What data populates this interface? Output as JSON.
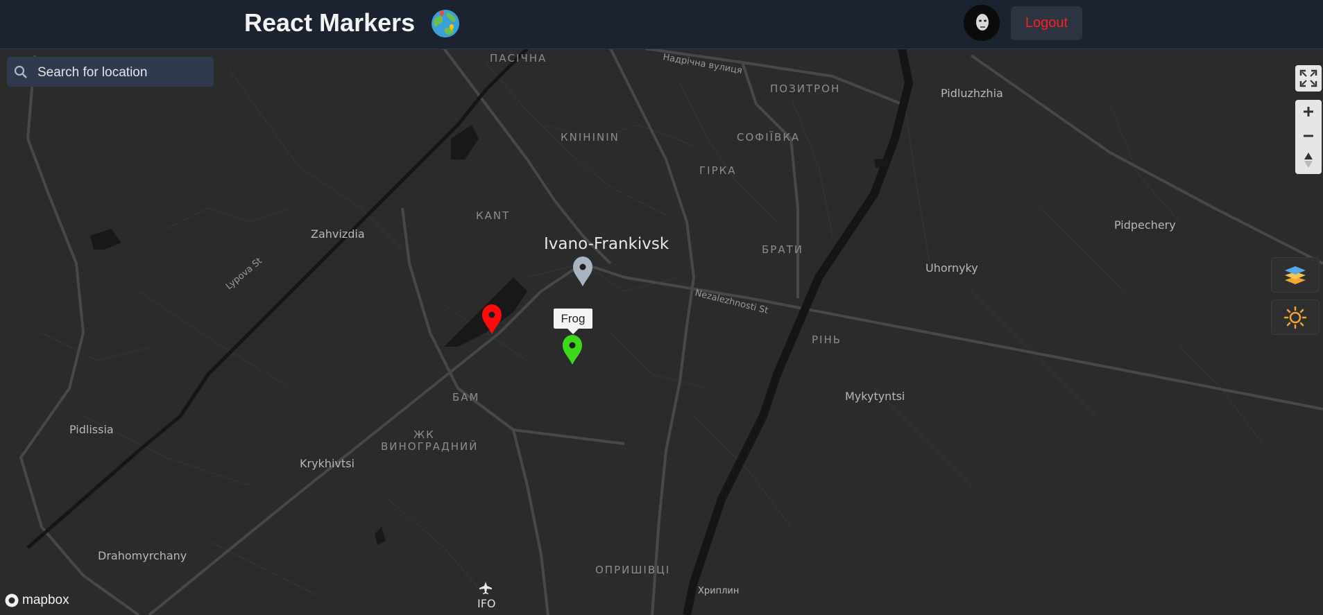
{
  "header": {
    "title": "React Markers",
    "logout_label": "Logout"
  },
  "search": {
    "placeholder": "Search for location"
  },
  "map": {
    "city_label": "Ivano-Frankivsk",
    "districts": [
      "ПАСІЧНА",
      "КNІHІNІN",
      "СОФІЇВКА",
      "ГІРКА",
      "ПОЗИТРОН",
      "КАNT",
      "БРАТИ",
      "РІНЬ",
      "БАМ",
      "ЖК",
      "ВИНОГРАДНИЙ",
      "ОПРИШІВЦІ"
    ],
    "places": [
      "Pidluzhzhia",
      "Zahvizdia",
      "Pidpechery",
      "Uhornyky",
      "Mykytyntsi",
      "Pidlissia",
      "Krykhivtsi",
      "Drahomyrchany",
      "Хриплин"
    ],
    "streets": [
      "Надрічна вулиця",
      "Lypova St",
      "Nezalezhnosti St"
    ],
    "airport_code": "IFO",
    "popup_label": "Frog",
    "attribution": "mapbox",
    "marker_colors": {
      "red": "#ff0000",
      "green": "#3dd81a",
      "grey": "#a9b4c2"
    }
  }
}
